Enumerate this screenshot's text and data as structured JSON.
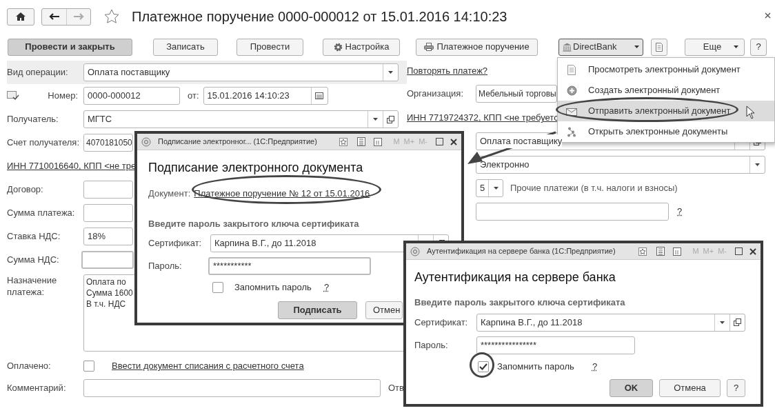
{
  "window": {
    "title": "Платежное поручение 0000-000012 от 15.01.2016 14:10:23",
    "nav": [
      {
        "kind": "back",
        "disabled": false
      },
      {
        "kind": "forward",
        "disabled": true
      }
    ]
  },
  "toolbar": {
    "buttons": [
      {
        "label": "Провести и закрыть",
        "kind": "default"
      },
      {
        "label": "Записать",
        "kind": "plain"
      },
      {
        "label": "Провести",
        "kind": "plain"
      },
      {
        "label": "Настройка",
        "kind": "settings"
      },
      {
        "label": "Платежное поручение",
        "kind": "print"
      }
    ],
    "directbank": {
      "label": "DirectBank",
      "expanded": true
    },
    "more": {
      "label": "Еще"
    },
    "help": {
      "label": "?"
    }
  },
  "menu": {
    "items": [
      {
        "label": "Просмотреть электронный документ",
        "selected": false
      },
      {
        "label": "Создать электронный документ",
        "selected": false
      },
      {
        "label": "Отправить электронный документ",
        "selected": true
      },
      {
        "label": "Открыть электронные документы",
        "selected": false
      }
    ]
  },
  "form": {
    "operation": {
      "label": "Вид операции:",
      "value": "Оплата поставщику"
    },
    "number": {
      "label": "Номер:",
      "value": "0000-000012",
      "date_label": "от:",
      "date": "15.01.2016 14:10:23"
    },
    "recipient": {
      "label": "Получатель:",
      "value": "МГТС"
    },
    "account": {
      "label": "Счет получателя:",
      "value": "4070181050"
    },
    "recipient_inn": "ИНН 7710016640, КПП <не тре",
    "contract": {
      "label": "Договор:"
    },
    "amount": {
      "label": "Сумма платежа:"
    },
    "vat_rate": {
      "label": "Ставка НДС:",
      "value": "18%"
    },
    "vat_amount": {
      "label": "Сумма НДС:"
    },
    "purpose": {
      "label": "Назначение платежа:",
      "lines": [
        "Оплата по",
        "Сумма 1600",
        "В т.ч. НДС"
      ]
    },
    "paid": {
      "label": "Оплачено:",
      "checked": false,
      "link": "Ввести документ списания с расчетного счета"
    },
    "comment": {
      "label": "Комментарий:"
    },
    "responsible_label": "Отв",
    "repeat_link": "Повторять платеж?",
    "organization": {
      "label": "Организация:",
      "value": "Мебельный торговы"
    },
    "org_inn": "ИНН 7719724372, КПП <не требуетс",
    "operation_type": {
      "value": "Оплата поставщику"
    },
    "method": {
      "value": "Электронно"
    },
    "priority": {
      "value": "5",
      "text": "Прочие платежи (в т.ч. налоги и взносы)"
    },
    "code": {
      "help": "?"
    }
  },
  "sign_dialog": {
    "title": "Подписание электронног...  (1С:Предприятие)",
    "title_buttons": [
      "M",
      "M+",
      "M-"
    ],
    "heading": "Подписание электронного документа",
    "document_label": "Документ:",
    "document_link": "Платежное поручение № 12 от 15.01.2016",
    "section": "Введите пароль закрытого ключа сертификата",
    "cert_label": "Сертификат:",
    "cert": "Карпина В.Г., до 11.2018",
    "password_label": "Пароль:",
    "password": "***********",
    "remember": {
      "label": "Запомнить пароль",
      "checked": false,
      "help": "?"
    },
    "buttons": [
      {
        "label": "Подписать",
        "kind": "default"
      },
      {
        "label": "Отмен",
        "kind": "plain"
      }
    ]
  },
  "auth_dialog": {
    "title": "Аутентификация на сервере банка  (1С:Предприятие)",
    "title_buttons": [
      "M",
      "M+",
      "M-"
    ],
    "heading": "Аутентификация на сервере банка",
    "section": "Введите пароль закрытого ключа сертификата",
    "cert_label": "Сертификат:",
    "cert": "Карпина В.Г., до 11.2018",
    "password_label": "Пароль:",
    "password": "****************",
    "remember": {
      "label": "Запомнить пароль",
      "checked": true,
      "help": "?"
    },
    "buttons": [
      {
        "label": "OK",
        "kind": "default"
      },
      {
        "label": "Отмена",
        "kind": "plain"
      },
      {
        "label": "?",
        "kind": "plain"
      }
    ]
  }
}
